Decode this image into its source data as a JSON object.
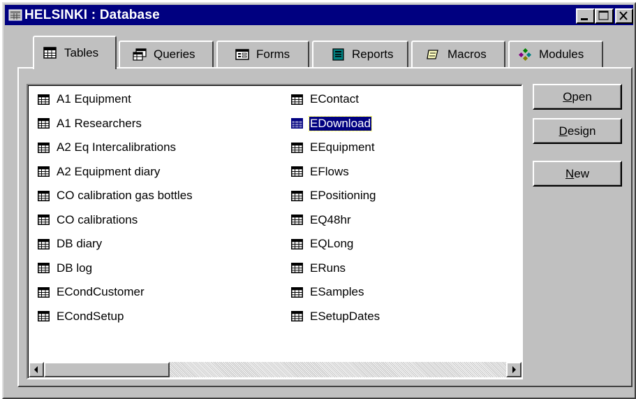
{
  "window": {
    "title": "HELSINKI : Database",
    "title_bg": "#000080",
    "face_color": "#c0c0c0"
  },
  "caption_buttons": [
    {
      "name": "minimize",
      "icon": "minimize-icon"
    },
    {
      "name": "maximize",
      "icon": "maximize-icon"
    },
    {
      "name": "close",
      "icon": "close-icon"
    }
  ],
  "tabs": [
    {
      "label": "Tables",
      "icon": "table-icon",
      "active": true
    },
    {
      "label": "Queries",
      "icon": "query-icon",
      "active": false
    },
    {
      "label": "Forms",
      "icon": "form-icon",
      "active": false
    },
    {
      "label": "Reports",
      "icon": "report-icon",
      "active": false
    },
    {
      "label": "Macros",
      "icon": "macro-icon",
      "active": false
    },
    {
      "label": "Modules",
      "icon": "module-icon",
      "active": false
    }
  ],
  "tables": {
    "column1": [
      "A1 Equipment",
      "A1 Researchers",
      "A2 Eq Intercalibrations",
      "A2 Equipment diary",
      "CO calibration gas bottles",
      "CO calibrations",
      "DB diary",
      "DB log",
      "ECondCustomer",
      "ECondSetup"
    ],
    "column2": [
      "EContact",
      "EDownload",
      "EEquipment",
      "EFlows",
      "EPositioning",
      "EQ48hr",
      "EQLong",
      "ERuns",
      "ESamples",
      "ESetupDates"
    ],
    "selected": "EDownload",
    "selection_color": "#000080"
  },
  "buttons": {
    "open": {
      "accel": "O",
      "rest": "pen"
    },
    "design": {
      "accel": "D",
      "rest": "esign"
    },
    "new": {
      "accel": "N",
      "rest": "ew"
    }
  },
  "scrollbar": {
    "left_icon": "arrow-left-icon",
    "right_icon": "arrow-right-icon"
  }
}
